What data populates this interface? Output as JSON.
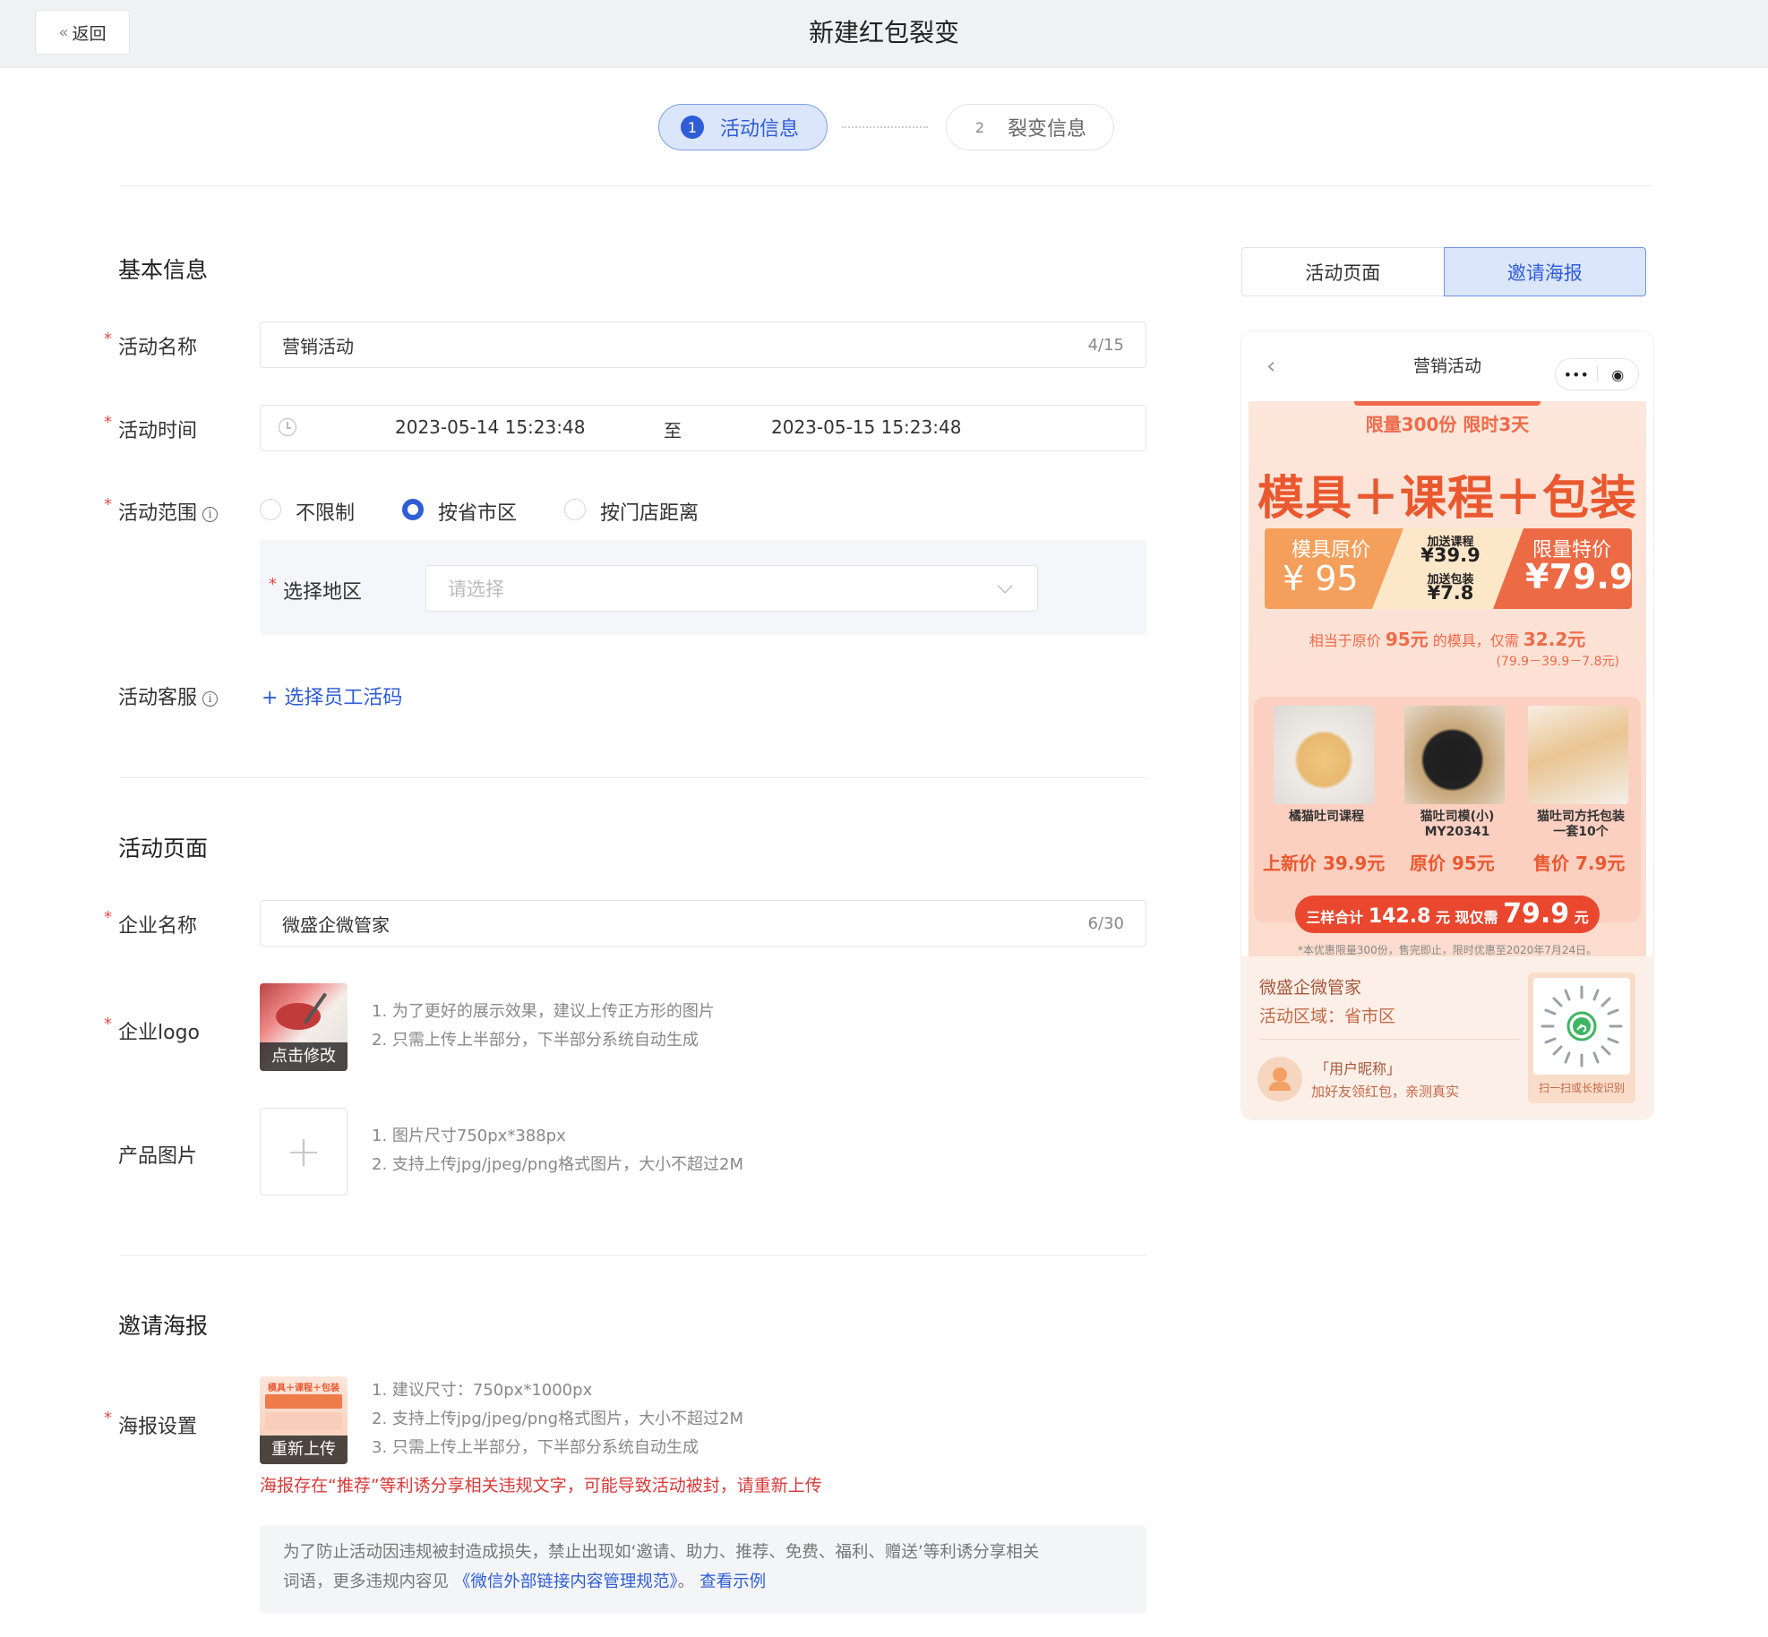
{
  "header": {
    "back_label": "返回",
    "title": "新建红包裂变"
  },
  "steps": [
    {
      "num": "1",
      "label": "活动信息"
    },
    {
      "num": "2",
      "label": "裂变信息"
    }
  ],
  "basic": {
    "title": "基本信息",
    "name_label": "活动名称",
    "name_value": "营销活动",
    "name_count": "4/15",
    "time_label": "活动时间",
    "time_start": "2023-05-14 15:23:48",
    "time_sep": "至",
    "time_end": "2023-05-15 15:23:48",
    "scope_label": "活动范围",
    "scope_options": [
      "不限制",
      "按省市区",
      "按门店距离"
    ],
    "scope_selected": "按省市区",
    "region_label": "选择地区",
    "region_placeholder": "请选择",
    "service_label": "活动客服",
    "service_action": "+ 选择员工活码"
  },
  "page": {
    "title": "活动页面",
    "company_label": "企业名称",
    "company_value": "微盛企微管家",
    "company_count": "6/30",
    "logo_label": "企业logo",
    "logo_overlay": "点击修改",
    "logo_hints": [
      "1. 为了更好的展示效果，建议上传正方形的图片",
      "2. 只需上传上半部分，下半部分系统自动生成"
    ],
    "product_label": "产品图片",
    "product_hints": [
      "1. 图片尺寸750px*388px",
      "2. 支持上传jpg/jpeg/png格式图片，大小不超过2M"
    ]
  },
  "poster_section": {
    "title": "邀请海报",
    "setting_label": "海报设置",
    "overlay": "重新上传",
    "thumb_text": "模具＋课程＋包装",
    "hints": [
      "1. 建议尺寸：750px*1000px",
      "2. 支持上传jpg/jpeg/png格式图片，大小不超过2M",
      "3. 只需上传上半部分，下半部分系统自动生成"
    ],
    "warning": "海报存在“推荐”等利诱分享相关违规文字，可能导致活动被封，请重新上传",
    "notice_line1": "为了防止活动因违规被封造成损失，禁止出现如‘邀请、助力、推荐、免费、福利、赠送’等利诱分享相关",
    "notice_line2_prefix": "词语，更多违规内容见",
    "notice_link": "《微信外部链接内容管理规范》",
    "notice_mid": "。",
    "notice_example": "查看示例"
  },
  "preview": {
    "tabs": [
      "活动页面",
      "邀请海报"
    ],
    "active_tab": "邀请海报",
    "phone_title": "营销活动",
    "poster": {
      "limit": "限量300份 限时3天",
      "headline": "模具＋课程＋包装",
      "orig_label": "模具原价",
      "orig_price": "¥ 95",
      "course_label": "加送课程",
      "course_price": "¥39.9",
      "pack_label": "加送包装",
      "pack_price": "¥7.8",
      "special_label": "限量特价",
      "special_price": "¥79.9",
      "equiv_pre": "相当于原价",
      "equiv_orig": "95元",
      "equiv_mid": "的模具，仅需",
      "equiv_final": "32.2元",
      "formula": "(79.9－39.9－7.8元)",
      "products": [
        {
          "name": "橘猫吐司课程",
          "price": "上新价 39.9元"
        },
        {
          "name": "猫吐司模(小)\nMY20341",
          "price": "原价 95元"
        },
        {
          "name": "猫吐司方托包装\n一套10个",
          "price": "售价 7.9元"
        }
      ],
      "total_pre": "三样合计",
      "total_sum": "142.8",
      "total_mid": "元 现仅需",
      "total_final": "79.9",
      "total_unit": "元",
      "note": "*本优惠限量300份，售完即止，限时优惠至2020年7月24日。"
    },
    "card": {
      "company": "微盛企微管家",
      "region": "活动区域：省市区",
      "nickname": "「用户昵称」",
      "slogan": "加好友领红包，亲测真实",
      "qr_caption": "扫一扫或长按识别"
    }
  },
  "colors": {
    "primary": "#2f5dd6",
    "danger": "#d93a3a",
    "poster_orange": "#e9582f"
  }
}
